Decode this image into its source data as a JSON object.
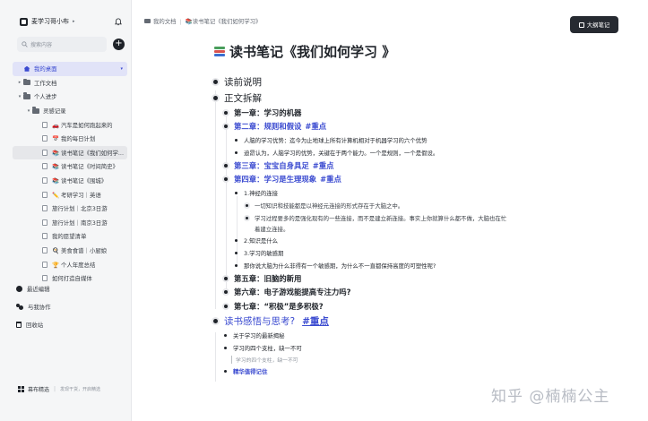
{
  "workspace": {
    "name": "麦学习哥小布",
    "logo_icon": "workspace-logo-icon",
    "menu_caret": "▸"
  },
  "search": {
    "placeholder": "搜索内容"
  },
  "sidebar": {
    "tree": [
      {
        "label": "我的桌面",
        "icon": "home-icon",
        "active": true,
        "indent": 0,
        "caret": ""
      },
      {
        "label": "工作文档",
        "icon": "folder-icon",
        "indent": 0,
        "caret": "▸"
      },
      {
        "label": "个人进步",
        "icon": "folder-icon",
        "indent": 0,
        "caret": "▾"
      },
      {
        "label": "灵感记录",
        "icon": "folder-icon",
        "indent": 1,
        "caret": "▾"
      },
      {
        "label": "🚗 汽车是如何跑起来的",
        "icon": "doc-icon",
        "indent": 2,
        "caret": ""
      },
      {
        "label": "📅 我的每日计划",
        "icon": "doc-icon",
        "indent": 2,
        "caret": ""
      },
      {
        "label": "📚 读书笔记《我们如何学...",
        "icon": "doc-icon",
        "indent": 2,
        "caret": "",
        "highlight": true
      },
      {
        "label": "📚 读书笔记《时间简史》",
        "icon": "doc-icon",
        "indent": 2,
        "caret": ""
      },
      {
        "label": "📚 读书笔记《围城》",
        "icon": "doc-icon",
        "indent": 2,
        "caret": ""
      },
      {
        "label": "✏️ 考研学习｜英语",
        "icon": "doc-icon",
        "indent": 2,
        "caret": ""
      },
      {
        "label": "旅行计划｜北京3日游",
        "icon": "doc-icon",
        "indent": 2,
        "caret": ""
      },
      {
        "label": "旅行计划｜南京3日游",
        "icon": "doc-icon",
        "indent": 2,
        "caret": ""
      },
      {
        "label": "我的愿望清单",
        "icon": "doc-icon",
        "indent": 2,
        "caret": ""
      },
      {
        "label": "🍳 美食食谱｜小厨娘",
        "icon": "doc-icon",
        "indent": 2,
        "caret": ""
      },
      {
        "label": "🏆 个人年度总结",
        "icon": "doc-icon",
        "indent": 2,
        "caret": ""
      },
      {
        "label": "如何打造自媒体",
        "icon": "doc-icon",
        "indent": 2,
        "caret": ""
      }
    ],
    "bottom_nav": [
      {
        "label": "最近编辑",
        "icon": "clock-icon"
      },
      {
        "label": "与我协作",
        "icon": "people-icon"
      },
      {
        "label": "回收站",
        "icon": "trash-icon"
      }
    ],
    "footer": {
      "brand": "幕布精选",
      "tagline": "发现干货，开启精选"
    }
  },
  "breadcrumb": {
    "root": "我的文档",
    "current": "📚读书笔记《我们如何学习》"
  },
  "mindmap_button": {
    "label": "大纲笔记"
  },
  "doc": {
    "title_emoji": "📚",
    "title": "读书笔记《我们如何学习 》",
    "items": [
      {
        "level": 1,
        "text": "读前说明"
      },
      {
        "level": 1,
        "text": "正文拆解"
      },
      {
        "level": 2,
        "text": "第一章：学习的机器"
      },
      {
        "level": 2,
        "text": "第二章：规则和假设",
        "tag": "#重点",
        "blue": true
      },
      {
        "level": 3,
        "text": "人脑的学习优势：迄今为止地球上所有计算机相对于机器学习的六个优势"
      },
      {
        "level": 3,
        "text": "迪昂认为，人脑学习的优势，关键在于两个能力。一个是规则，一个是假设。"
      },
      {
        "level": 2,
        "text": "第三章：宝宝自身具足",
        "tag": "#重点",
        "blue": true,
        "tag_plain": true
      },
      {
        "level": 2,
        "text": "第四章：学习是生理现象",
        "tag": "#重点",
        "blue": true,
        "tag_plain": true
      },
      {
        "level": 3,
        "text": "1.神经的连接"
      },
      {
        "level": 4,
        "text": "一切知识和技能都是以神经元连接的形式存在于大脑之中。"
      },
      {
        "level": 4,
        "text": "学习过程要多的是强化现有的一些连接，而不是建立新连接。事实上你就算什么都不做，大脑也在忙"
      },
      {
        "level": 5,
        "text": "着建立连接。"
      },
      {
        "level": 3,
        "text": "2.知识是什么"
      },
      {
        "level": 3,
        "text": "3.学习的敏感期"
      },
      {
        "level": 3,
        "text": "那你说大脑为什么非得有一个敏感期，为什么不一直都保持高度的可塑性呢?"
      },
      {
        "level": 2,
        "text": "第五章：旧脑的新用"
      },
      {
        "level": 2,
        "text": "第六章：电子游戏能提高专注力吗?"
      },
      {
        "level": 2,
        "text": "第七章：“积极”是多积极?"
      },
      {
        "level": 1,
        "text": "读书感悟与思考?",
        "tag": "#重点",
        "blue": true
      },
      {
        "level": 3,
        "text": "关于学习的最新揭秘"
      },
      {
        "level": 3,
        "text": "学习的四个支柱，缺一不可"
      },
      {
        "level": 6,
        "text": "学习的四个支柱，缺一不可"
      },
      {
        "level": 3,
        "text": "精华值得记住",
        "blue": true,
        "bold": true
      }
    ]
  },
  "watermark": "知乎 @楠楠公主"
}
